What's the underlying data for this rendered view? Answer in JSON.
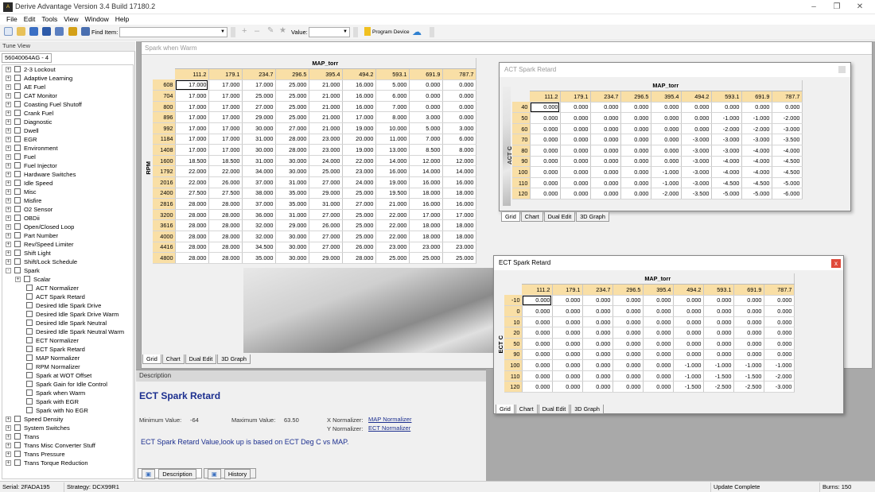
{
  "app": {
    "title": "Derive Advantage Version 3.4 Build 17180.2"
  },
  "menu": [
    "File",
    "Edit",
    "Tools",
    "View",
    "Window",
    "Help"
  ],
  "toolbar": {
    "find_label": "Find Item:",
    "find_value": "",
    "value_label": "Value:",
    "value_value": "",
    "program_label": "Program Device"
  },
  "tuneview": {
    "title": "Tune View",
    "tab": "56040064AG - 4",
    "items": [
      {
        "label": "2-3 Lockout",
        "level": 0,
        "expand": "+"
      },
      {
        "label": "Adaptive Learning",
        "level": 0,
        "expand": "+"
      },
      {
        "label": "AE Fuel",
        "level": 0,
        "expand": "+"
      },
      {
        "label": "CAT Monitor",
        "level": 0,
        "expand": "+"
      },
      {
        "label": "Coasting Fuel Shutoff",
        "level": 0,
        "expand": "+"
      },
      {
        "label": "Crank Fuel",
        "level": 0,
        "expand": "+"
      },
      {
        "label": "Diagnostic",
        "level": 0,
        "expand": "+"
      },
      {
        "label": "Dwell",
        "level": 0,
        "expand": "+"
      },
      {
        "label": "EGR",
        "level": 0,
        "expand": "+"
      },
      {
        "label": "Environment",
        "level": 0,
        "expand": "+"
      },
      {
        "label": "Fuel",
        "level": 0,
        "expand": "+"
      },
      {
        "label": "Fuel Injector",
        "level": 0,
        "expand": "+"
      },
      {
        "label": "Hardware Switches",
        "level": 0,
        "expand": "+"
      },
      {
        "label": "Idle Speed",
        "level": 0,
        "expand": "+"
      },
      {
        "label": "Misc",
        "level": 0,
        "expand": "+"
      },
      {
        "label": "Misfire",
        "level": 0,
        "expand": "+"
      },
      {
        "label": "O2 Sensor",
        "level": 0,
        "expand": "+"
      },
      {
        "label": "OBDii",
        "level": 0,
        "expand": "+"
      },
      {
        "label": "Open/Closed Loop",
        "level": 0,
        "expand": "+"
      },
      {
        "label": "Part Number",
        "level": 0,
        "expand": "+"
      },
      {
        "label": "Rev/Speed Limiter",
        "level": 0,
        "expand": "+"
      },
      {
        "label": "Shift Light",
        "level": 0,
        "expand": "+"
      },
      {
        "label": "Shift/Lock Schedule",
        "level": 0,
        "expand": "+"
      },
      {
        "label": "Spark",
        "level": 0,
        "expand": "-"
      },
      {
        "label": "Scalar",
        "level": 1,
        "expand": "+"
      },
      {
        "label": "ACT Normalizer",
        "level": 2,
        "expand": ""
      },
      {
        "label": "ACT Spark Retard",
        "level": 2,
        "expand": ""
      },
      {
        "label": "Desired Idle Spark Drive",
        "level": 2,
        "expand": ""
      },
      {
        "label": "Desired Idle Spark Drive Warm",
        "level": 2,
        "expand": ""
      },
      {
        "label": "Desired Idle Spark Neutral",
        "level": 2,
        "expand": ""
      },
      {
        "label": "Desired Idle Spark Neutral Warm",
        "level": 2,
        "expand": ""
      },
      {
        "label": "ECT Normalizer",
        "level": 2,
        "expand": ""
      },
      {
        "label": "ECT Spark Retard",
        "level": 2,
        "expand": ""
      },
      {
        "label": "MAP Normalizer",
        "level": 2,
        "expand": ""
      },
      {
        "label": "RPM Normalizer",
        "level": 2,
        "expand": ""
      },
      {
        "label": "Spark at WOT Offset",
        "level": 2,
        "expand": ""
      },
      {
        "label": "Spark Gain for Idle Control",
        "level": 2,
        "expand": ""
      },
      {
        "label": "Spark when Warm",
        "level": 2,
        "expand": ""
      },
      {
        "label": "Spark with EGR",
        "level": 2,
        "expand": ""
      },
      {
        "label": "Spark with No EGR",
        "level": 2,
        "expand": ""
      },
      {
        "label": "Speed Density",
        "level": 0,
        "expand": "+"
      },
      {
        "label": "System Switches",
        "level": 0,
        "expand": "+"
      },
      {
        "label": "Trans",
        "level": 0,
        "expand": "+"
      },
      {
        "label": "Trans Misc Converter Stuff",
        "level": 0,
        "expand": "+"
      },
      {
        "label": "Trans Pressure",
        "level": 0,
        "expand": "+"
      },
      {
        "label": "Trans Torque Reduction",
        "level": 0,
        "expand": "+"
      }
    ]
  },
  "spark_warm": {
    "title": "Spark when Warm",
    "col_header": "MAP_torr",
    "row_header": "RPM",
    "cols": [
      "111.2",
      "179.1",
      "234.7",
      "296.5",
      "395.4",
      "494.2",
      "593.1",
      "691.9",
      "787.7"
    ],
    "rows": [
      "608",
      "704",
      "800",
      "896",
      "992",
      "1184",
      "1408",
      "1600",
      "1792",
      "2016",
      "2400",
      "2816",
      "3200",
      "3616",
      "4000",
      "4416",
      "4800"
    ],
    "cells": [
      [
        "17.000",
        "17.000",
        "17.000",
        "25.000",
        "21.000",
        "16.000",
        "5.000",
        "0.000",
        "0.000"
      ],
      [
        "17.000",
        "17.000",
        "25.000",
        "25.000",
        "21.000",
        "16.000",
        "6.000",
        "0.000",
        "0.000"
      ],
      [
        "17.000",
        "17.000",
        "27.000",
        "25.000",
        "21.000",
        "16.000",
        "7.000",
        "0.000",
        "0.000"
      ],
      [
        "17.000",
        "17.000",
        "29.000",
        "25.000",
        "21.000",
        "17.000",
        "8.000",
        "3.000",
        "0.000"
      ],
      [
        "17.000",
        "17.000",
        "30.000",
        "27.000",
        "21.000",
        "19.000",
        "10.000",
        "5.000",
        "3.000"
      ],
      [
        "17.000",
        "17.000",
        "31.000",
        "28.000",
        "23.000",
        "20.000",
        "11.000",
        "7.000",
        "6.000"
      ],
      [
        "17.000",
        "17.000",
        "30.000",
        "28.000",
        "23.000",
        "19.000",
        "13.000",
        "8.500",
        "8.000"
      ],
      [
        "18.500",
        "18.500",
        "31.000",
        "30.000",
        "24.000",
        "22.000",
        "14.000",
        "12.000",
        "12.000"
      ],
      [
        "22.000",
        "22.000",
        "34.000",
        "30.000",
        "25.000",
        "23.000",
        "16.000",
        "14.000",
        "14.000"
      ],
      [
        "22.000",
        "26.000",
        "37.000",
        "31.000",
        "27.000",
        "24.000",
        "19.000",
        "16.000",
        "16.000"
      ],
      [
        "27.500",
        "27.500",
        "38.000",
        "35.000",
        "29.000",
        "25.000",
        "19.500",
        "18.000",
        "18.000"
      ],
      [
        "28.000",
        "28.000",
        "37.000",
        "35.000",
        "31.000",
        "27.000",
        "21.000",
        "16.000",
        "16.000"
      ],
      [
        "28.000",
        "28.000",
        "36.000",
        "31.000",
        "27.000",
        "25.000",
        "22.000",
        "17.000",
        "17.000"
      ],
      [
        "28.000",
        "28.000",
        "32.000",
        "29.000",
        "26.000",
        "25.000",
        "22.000",
        "18.000",
        "18.000"
      ],
      [
        "28.000",
        "28.000",
        "32.000",
        "30.000",
        "27.000",
        "25.000",
        "22.000",
        "18.000",
        "18.000"
      ],
      [
        "28.000",
        "28.000",
        "34.500",
        "30.000",
        "27.000",
        "26.000",
        "23.000",
        "23.000",
        "23.000"
      ],
      [
        "28.000",
        "28.000",
        "35.000",
        "30.000",
        "29.000",
        "28.000",
        "25.000",
        "25.000",
        "25.000"
      ]
    ],
    "tabs": [
      "Grid",
      "Chart",
      "Dual Edit",
      "3D Graph"
    ]
  },
  "act_window": {
    "title": "ACT Spark Retard",
    "col_header": "MAP_torr",
    "row_header": "ACT C",
    "cols": [
      "111.2",
      "179.1",
      "234.7",
      "296.5",
      "395.4",
      "494.2",
      "593.1",
      "691.9",
      "787.7"
    ],
    "rows": [
      "40",
      "50",
      "60",
      "70",
      "80",
      "90",
      "100",
      "110",
      "120"
    ],
    "cells": [
      [
        "0.000",
        "0.000",
        "0.000",
        "0.000",
        "0.000",
        "0.000",
        "0.000",
        "0.000",
        "0.000"
      ],
      [
        "0.000",
        "0.000",
        "0.000",
        "0.000",
        "0.000",
        "0.000",
        "-1.000",
        "-1.000",
        "-2.000"
      ],
      [
        "0.000",
        "0.000",
        "0.000",
        "0.000",
        "0.000",
        "0.000",
        "-2.000",
        "-2.000",
        "-3.000"
      ],
      [
        "0.000",
        "0.000",
        "0.000",
        "0.000",
        "0.000",
        "-3.000",
        "-3.000",
        "-3.000",
        "-3.500"
      ],
      [
        "0.000",
        "0.000",
        "0.000",
        "0.000",
        "0.000",
        "-3.000",
        "-3.000",
        "-4.000",
        "-4.000"
      ],
      [
        "0.000",
        "0.000",
        "0.000",
        "0.000",
        "0.000",
        "-3.000",
        "-4.000",
        "-4.000",
        "-4.500"
      ],
      [
        "0.000",
        "0.000",
        "0.000",
        "0.000",
        "-1.000",
        "-3.000",
        "-4.000",
        "-4.000",
        "-4.500"
      ],
      [
        "0.000",
        "0.000",
        "0.000",
        "0.000",
        "-1.000",
        "-3.000",
        "-4.500",
        "-4.500",
        "-5.000"
      ],
      [
        "0.000",
        "0.000",
        "0.000",
        "0.000",
        "-2.000",
        "-3.500",
        "-5.000",
        "-5.000",
        "-6.000"
      ]
    ],
    "tabs": [
      "Grid",
      "Chart",
      "Dual Edit",
      "3D Graph"
    ]
  },
  "ect_window": {
    "title": "ECT Spark Retard",
    "close": "x",
    "col_header": "MAP_torr",
    "row_header": "ECT C",
    "cols": [
      "111.2",
      "179.1",
      "234.7",
      "296.5",
      "395.4",
      "494.2",
      "593.1",
      "691.9",
      "787.7"
    ],
    "rows": [
      "-10",
      "0",
      "10",
      "20",
      "50",
      "90",
      "100",
      "110",
      "120"
    ],
    "cells": [
      [
        "0.000",
        "0.000",
        "0.000",
        "0.000",
        "0.000",
        "0.000",
        "0.000",
        "0.000",
        "0.000"
      ],
      [
        "0.000",
        "0.000",
        "0.000",
        "0.000",
        "0.000",
        "0.000",
        "0.000",
        "0.000",
        "0.000"
      ],
      [
        "0.000",
        "0.000",
        "0.000",
        "0.000",
        "0.000",
        "0.000",
        "0.000",
        "0.000",
        "0.000"
      ],
      [
        "0.000",
        "0.000",
        "0.000",
        "0.000",
        "0.000",
        "0.000",
        "0.000",
        "0.000",
        "0.000"
      ],
      [
        "0.000",
        "0.000",
        "0.000",
        "0.000",
        "0.000",
        "0.000",
        "0.000",
        "0.000",
        "0.000"
      ],
      [
        "0.000",
        "0.000",
        "0.000",
        "0.000",
        "0.000",
        "0.000",
        "0.000",
        "0.000",
        "0.000"
      ],
      [
        "0.000",
        "0.000",
        "0.000",
        "0.000",
        "0.000",
        "-1.000",
        "-1.000",
        "-1.000",
        "-1.000"
      ],
      [
        "0.000",
        "0.000",
        "0.000",
        "0.000",
        "0.000",
        "-1.000",
        "-1.500",
        "-1.500",
        "-2.000"
      ],
      [
        "0.000",
        "0.000",
        "0.000",
        "0.000",
        "0.000",
        "-1.500",
        "-2.500",
        "-2.500",
        "-3.000"
      ]
    ],
    "tabs": [
      "Grid",
      "Chart",
      "Dual Edit",
      "3D Graph"
    ]
  },
  "description": {
    "header": "Description",
    "title": "ECT Spark Retard",
    "min_label": "Minimum Value:",
    "min_value": "-64",
    "max_label": "Maximum Value:",
    "max_value": "63.50",
    "xnorm_label": "X Normalizer:",
    "xnorm_value": "MAP Normalizer",
    "ynorm_label": "Y Normalizer:",
    "ynorm_value": "ECT Normalizer",
    "text": "ECT Spark Retard Value,look up is based on ECT Deg C vs MAP.",
    "tabs": [
      "Description",
      "History"
    ]
  },
  "status": {
    "serial": "Serial: 2FADA195",
    "strategy": "Strategy: DCX99R1",
    "update": "Update Complete",
    "burns": "Burns: 150"
  }
}
